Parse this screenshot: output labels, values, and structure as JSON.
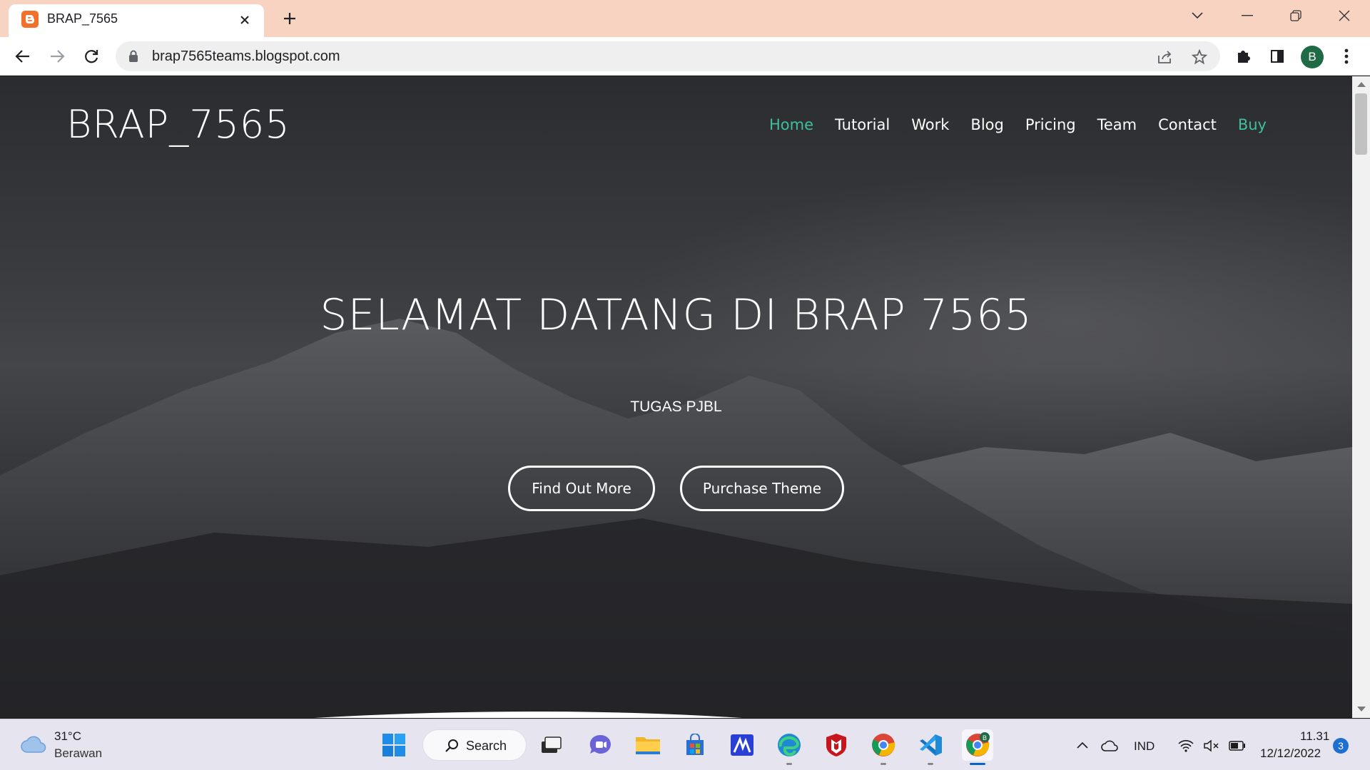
{
  "browser": {
    "tab_title": "BRAP_7565",
    "url": "brap7565teams.blogspot.com",
    "profile_initial": "B"
  },
  "site": {
    "logo": "BRAP_7565",
    "nav": [
      "Home",
      "Tutorial",
      "Work",
      "Blog",
      "Pricing",
      "Team",
      "Contact",
      "Buy"
    ],
    "accent_color": "#3fbf9f",
    "hero_title": "SELAMAT DATANG DI BRAP 7565",
    "hero_subtitle": "TUGAS PJBL",
    "buttons": {
      "primary": "Find Out More",
      "secondary": "Purchase Theme"
    }
  },
  "taskbar": {
    "weather_temp": "31°C",
    "weather_desc": "Berawan",
    "search_label": "Search",
    "language": "IND",
    "time": "11.31",
    "date": "12/12/2022",
    "notifications": "3",
    "apps": [
      "start-icon",
      "task-view-icon",
      "teams-chat-icon",
      "file-explorer-icon",
      "microsoft-store-icon",
      "app-icon",
      "edge-icon",
      "mcafee-icon",
      "chrome-icon",
      "vscode-icon",
      "chrome-profile-icon"
    ]
  }
}
